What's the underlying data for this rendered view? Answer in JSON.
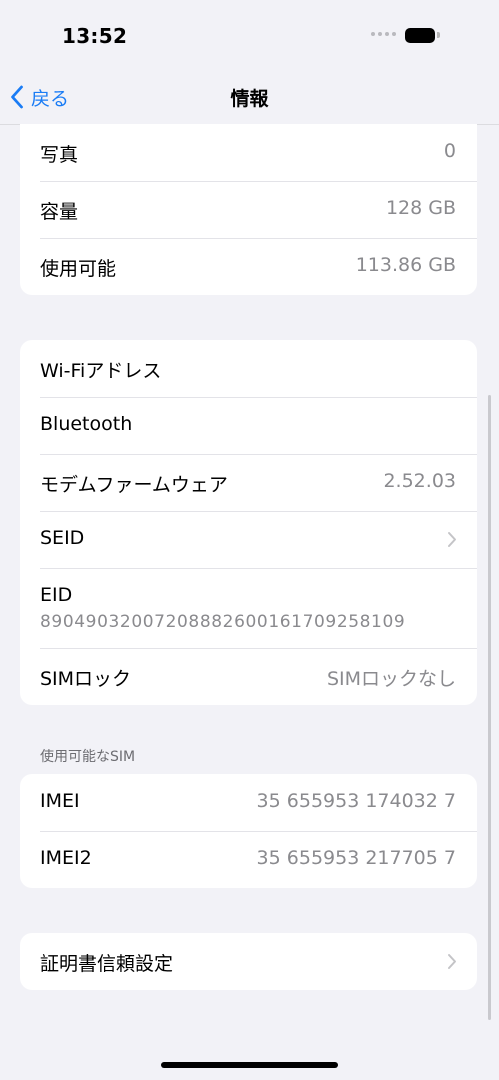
{
  "status_bar": {
    "time": "13:52"
  },
  "nav": {
    "back_label": "戻る",
    "title": "情報"
  },
  "storage_group": [
    {
      "label": "写真",
      "value": "0"
    },
    {
      "label": "容量",
      "value": "128 GB"
    },
    {
      "label": "使用可能",
      "value": "113.86 GB"
    }
  ],
  "network_group": {
    "wifi": {
      "label": "Wi-Fiアドレス",
      "value": ""
    },
    "bluetooth": {
      "label": "Bluetooth",
      "value": ""
    },
    "modem": {
      "label": "モデムファームウェア",
      "value": "2.52.03"
    },
    "seid": {
      "label": "SEID"
    },
    "eid": {
      "label": "EID",
      "value": "89049032007208882600161709258109"
    },
    "sim_lock": {
      "label": "SIMロック",
      "value": "SIMロックなし"
    }
  },
  "sim_section": {
    "header": "使用可能なSIM",
    "rows": [
      {
        "label": "IMEI",
        "value": "35 655953 174032 7"
      },
      {
        "label": "IMEI2",
        "value": "35 655953 217705 7"
      }
    ]
  },
  "certificate": {
    "label": "証明書信頼設定"
  },
  "colors": {
    "accent": "#1a7cf5",
    "background": "#f2f2f7",
    "secondary_text": "#8a8a8e"
  },
  "icons": [
    "chevron-left-icon",
    "chevron-right-icon",
    "battery-icon",
    "signal-icon"
  ]
}
